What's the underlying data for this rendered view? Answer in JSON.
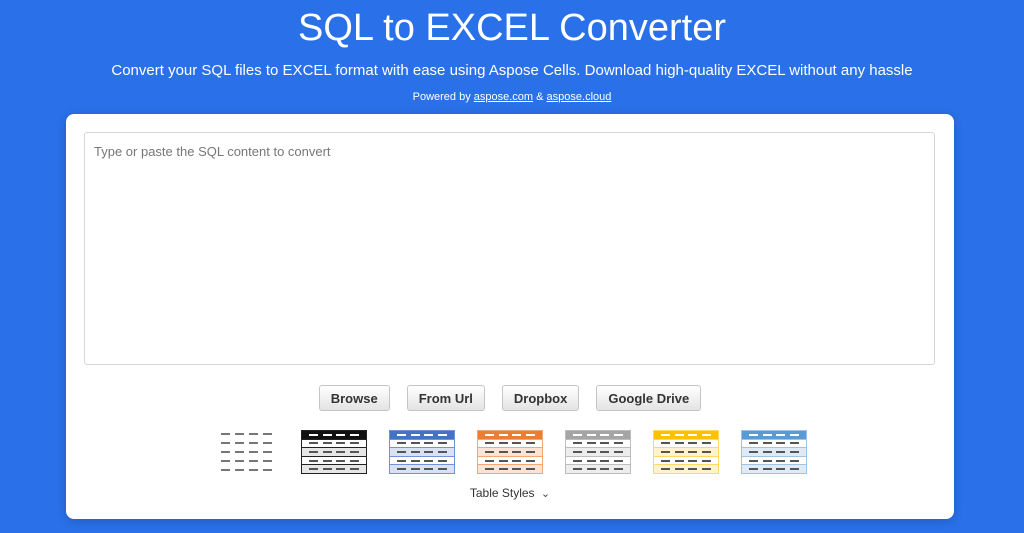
{
  "header": {
    "title": "SQL to EXCEL Converter",
    "subtitle": "Convert your SQL files to EXCEL format with ease using Aspose Cells. Download high-quality EXCEL without any hassle",
    "powered_prefix": "Powered by",
    "powered_link1": "aspose.com",
    "powered_sep": "&",
    "powered_link2": "aspose.cloud"
  },
  "editor": {
    "placeholder": "Type or paste the SQL content to convert"
  },
  "buttons": {
    "browse": "Browse",
    "from_url": "From Url",
    "dropbox": "Dropbox",
    "google_drive": "Google Drive"
  },
  "table_styles": {
    "label": "Table Styles",
    "chevron_icon": "chevron-down-icon",
    "styles": [
      {
        "id": "none",
        "header": "",
        "border": "",
        "alt": ""
      },
      {
        "id": "black",
        "header": "#111111",
        "border": "#222222",
        "alt": "#e6e6e6"
      },
      {
        "id": "blue",
        "header": "#4472c4",
        "border": "#6f93d6",
        "alt": "#d9e2f3"
      },
      {
        "id": "orange",
        "header": "#ed7d31",
        "border": "#f0a774",
        "alt": "#fbe4d5"
      },
      {
        "id": "gray",
        "header": "#a5a5a5",
        "border": "#bdbdbd",
        "alt": "#ededed"
      },
      {
        "id": "gold",
        "header": "#ffc000",
        "border": "#ffd966",
        "alt": "#fff2cc"
      },
      {
        "id": "lightblue",
        "header": "#5b9bd5",
        "border": "#9dc3e6",
        "alt": "#deebf6"
      }
    ]
  },
  "colors": {
    "background": "#2a70e8",
    "card": "#ffffff"
  }
}
